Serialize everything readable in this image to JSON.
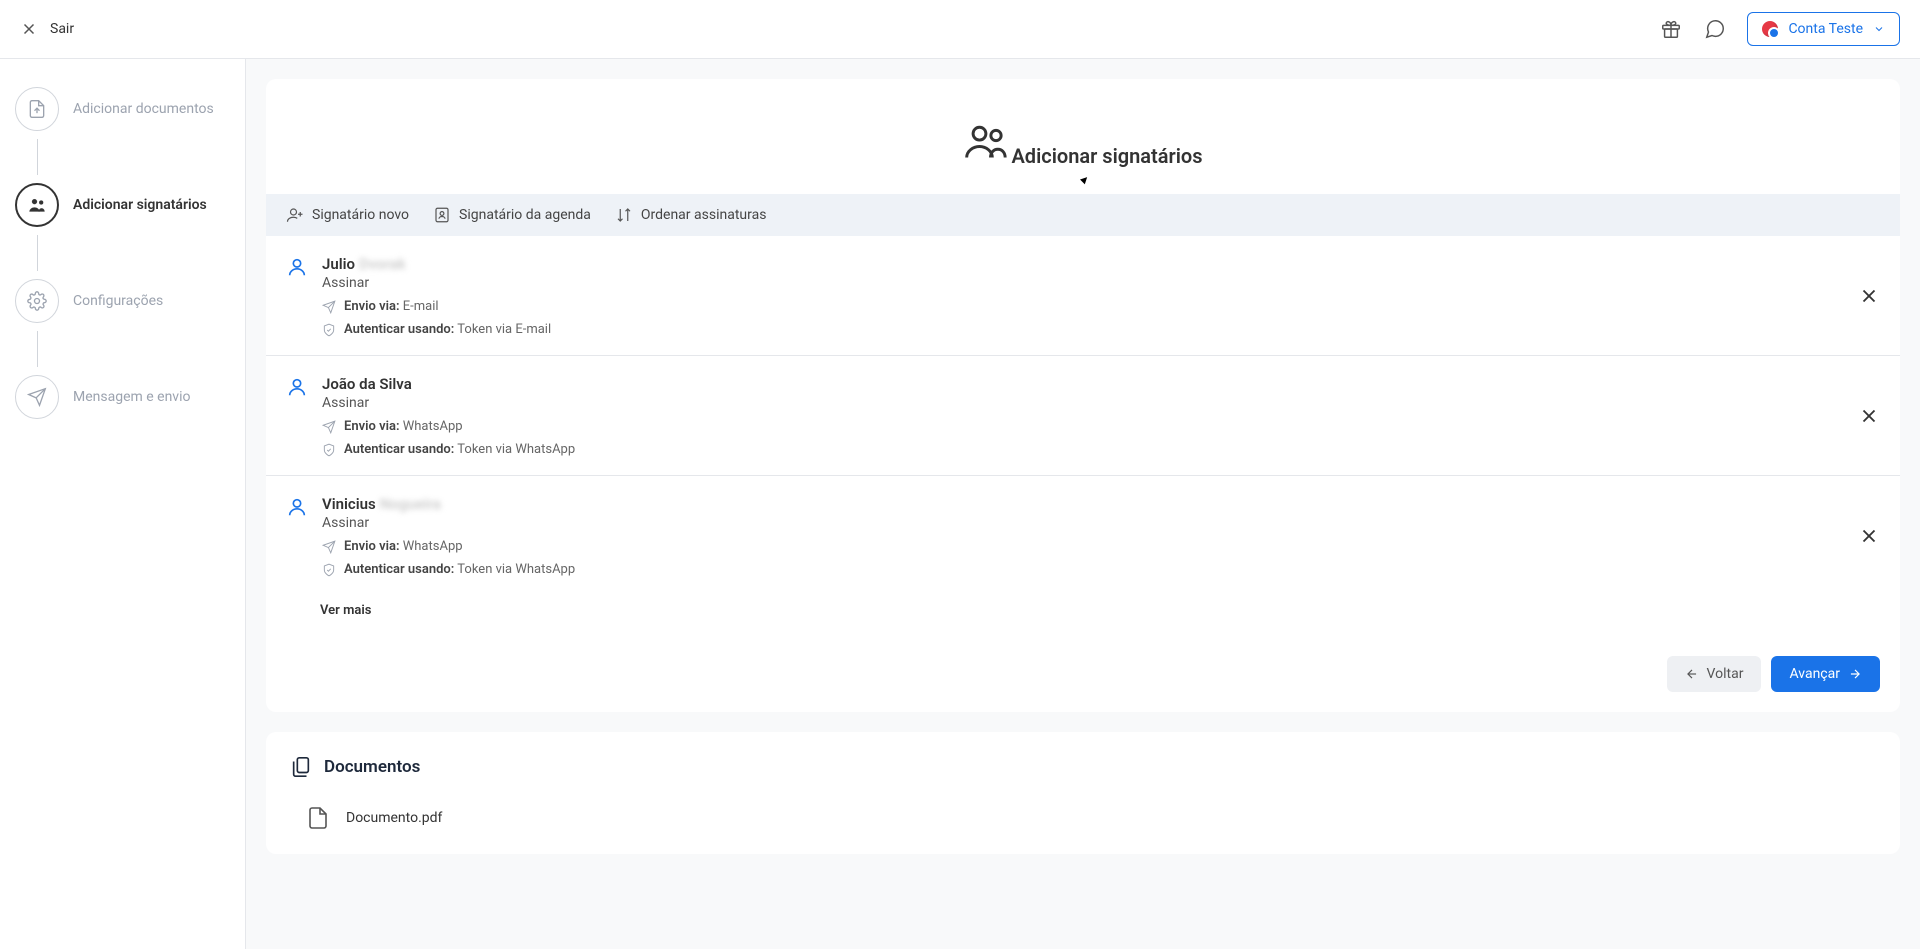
{
  "header": {
    "exit_label": "Sair",
    "account_label": "Conta Teste"
  },
  "sidebar": {
    "steps": [
      {
        "label": "Adicionar documentos"
      },
      {
        "label": "Adicionar signatários"
      },
      {
        "label": "Configurações"
      },
      {
        "label": "Mensagem e envio"
      }
    ]
  },
  "main": {
    "title": "Adicionar signatários",
    "toolbar": {
      "new_signer": "Signatário novo",
      "from_contacts": "Signatário da agenda",
      "order": "Ordenar assinaturas"
    },
    "labels": {
      "send_via": "Envio via:",
      "auth_using": "Autenticar usando:"
    },
    "signers": [
      {
        "name_visible": "Julio",
        "name_blurred": "Dvorak",
        "role": "Assinar",
        "send_via": "E-mail",
        "auth": "Token via E-mail"
      },
      {
        "name_visible": "João da Silva",
        "name_blurred": "",
        "role": "Assinar",
        "send_via": "WhatsApp",
        "auth": "Token via WhatsApp"
      },
      {
        "name_visible": "Vinicius",
        "name_blurred": "Nogueira",
        "role": "Assinar",
        "send_via": "WhatsApp",
        "auth": "Token via WhatsApp"
      }
    ],
    "view_more": "Ver mais",
    "back_label": "Voltar",
    "next_label": "Avançar"
  },
  "documents": {
    "title": "Documentos",
    "items": [
      {
        "name": "Documento.pdf"
      }
    ]
  }
}
